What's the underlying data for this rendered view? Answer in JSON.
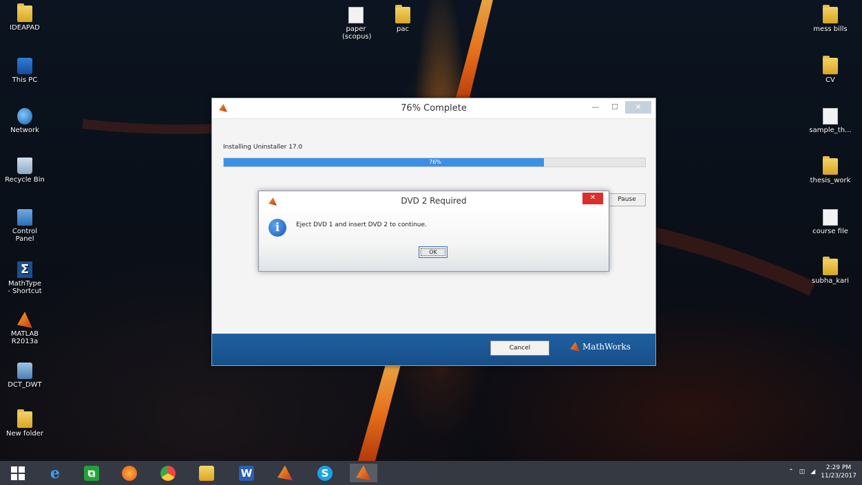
{
  "desktop": {
    "left_icons": [
      {
        "label": "IDEAPAD",
        "icon": "folder-icon"
      },
      {
        "label": "This PC",
        "icon": "computer-icon"
      },
      {
        "label": "Network",
        "icon": "network-icon"
      },
      {
        "label": "Recycle Bin",
        "icon": "recycle-bin-icon"
      },
      {
        "label": "Control Panel",
        "icon": "control-panel-icon"
      },
      {
        "label": "MathType - Shortcut",
        "icon": "mathtype-icon"
      },
      {
        "label": "MATLAB R2013a",
        "icon": "matlab-icon"
      },
      {
        "label": "DCT_DWT",
        "icon": "app-icon"
      },
      {
        "label": "New folder",
        "icon": "folder-icon"
      }
    ],
    "top_icons": [
      {
        "label": "paper (scopus)",
        "icon": "document-icon"
      },
      {
        "label": "pac",
        "icon": "folder-icon"
      }
    ],
    "right_icons": [
      {
        "label": "mess bills",
        "icon": "folder-icon"
      },
      {
        "label": "CV",
        "icon": "folder-icon"
      },
      {
        "label": "sample_th...",
        "icon": "document-icon"
      },
      {
        "label": "thesis_work",
        "icon": "folder-icon"
      },
      {
        "label": "course file",
        "icon": "document-icon"
      },
      {
        "label": "subha_kari",
        "icon": "folder-icon"
      }
    ]
  },
  "installer": {
    "title": "76% Complete",
    "status": "Installing Uninstaller 17.0",
    "progress_percent": 76,
    "progress_label": "76%",
    "pause_label": "Pause",
    "cancel_label": "Cancel",
    "brand": "MathWorks"
  },
  "dialog": {
    "title": "DVD 2 Required",
    "close_label": "✕",
    "message": "Eject DVD 1 and insert DVD 2 to continue.",
    "ok_label": "OK"
  },
  "taskbar": {
    "apps": [
      "start",
      "internet-explorer",
      "store",
      "firefox",
      "chrome",
      "file-explorer",
      "word",
      "matlab",
      "skype",
      "matlab-installer"
    ],
    "time": "2:29 PM",
    "date": "11/23/2017"
  }
}
